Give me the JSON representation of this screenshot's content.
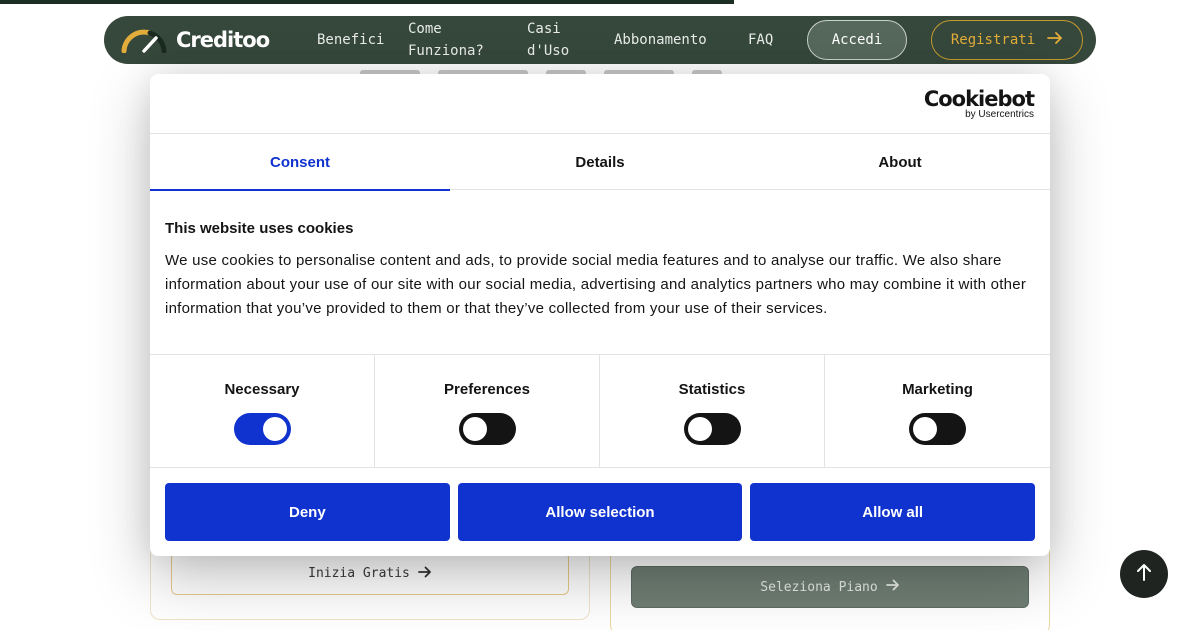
{
  "navbar": {
    "brand": "Creditoo",
    "items": [
      {
        "label": "Benefici"
      },
      {
        "label": "Come Funziona?"
      },
      {
        "label": "Casi d'Uso"
      },
      {
        "label": "Abbonamento"
      },
      {
        "label": "FAQ"
      }
    ],
    "login_label": "Accedi",
    "register_label": "Registrati",
    "colors": {
      "bar": "#36473c",
      "accent": "#e2ad3a"
    }
  },
  "background": {
    "free_plan_button": "Inizia Gratis",
    "select_plan_button": "Seleziona Piano"
  },
  "cookie_dialog": {
    "logo_main": "Cookiebot",
    "logo_sub": "by Usercentrics",
    "tabs": [
      {
        "label": "Consent",
        "active": true
      },
      {
        "label": "Details",
        "active": false
      },
      {
        "label": "About",
        "active": false
      }
    ],
    "title": "This website uses cookies",
    "text": "We use cookies to personalise content and ads, to provide social media features and to analyse our traffic. We also share information about your use of our site with our social media, advertising and analytics partners who may combine it with other information that you’ve provided to them or that they’ve collected from your use of their services.",
    "levels": [
      {
        "label": "Necessary",
        "enabled": true
      },
      {
        "label": "Preferences",
        "enabled": false
      },
      {
        "label": "Statistics",
        "enabled": false
      },
      {
        "label": "Marketing",
        "enabled": false
      }
    ],
    "buttons": {
      "deny": "Deny",
      "allow_selection": "Allow selection",
      "allow_all": "Allow all"
    },
    "colors": {
      "primary": "#1032cf"
    }
  }
}
